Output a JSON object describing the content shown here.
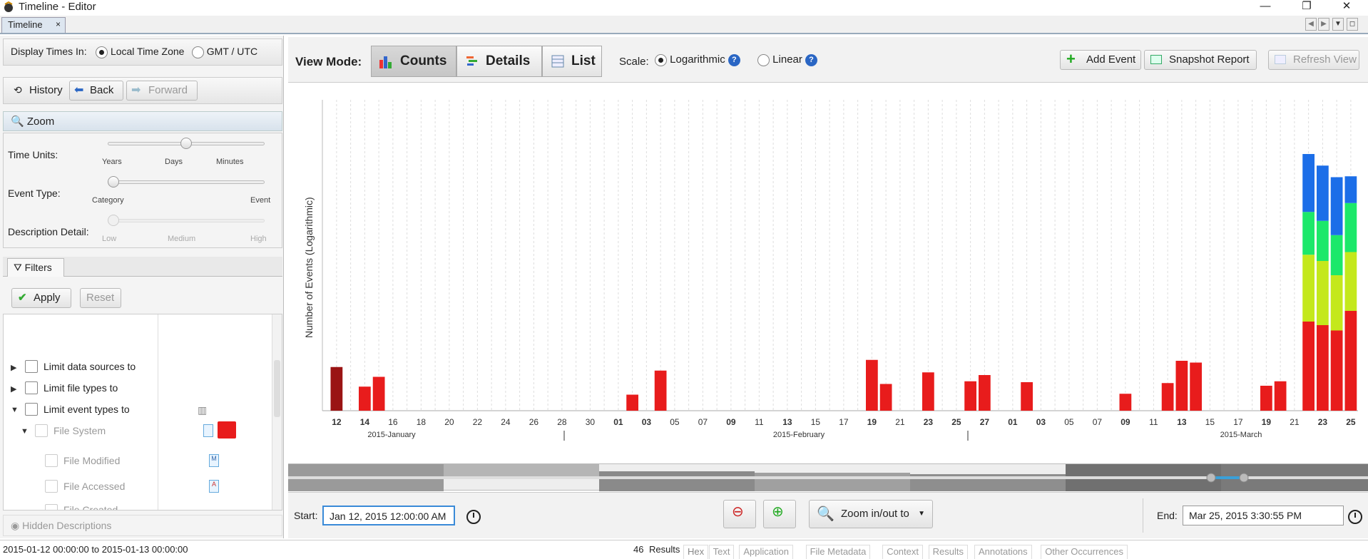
{
  "window": {
    "title": "Timeline - Editor",
    "minimize": "—",
    "restore": "❐",
    "close": "✕"
  },
  "tabs": {
    "timeline": "Timeline",
    "close": "×"
  },
  "display_times": {
    "label": "Display Times In:",
    "local": "Local Time Zone",
    "gmt": "GMT / UTC",
    "selected": "local"
  },
  "history": {
    "label": "History",
    "back": "Back",
    "forward": "Forward"
  },
  "zoom": {
    "title": "Zoom",
    "time_units": {
      "label": "Time Units:",
      "ticks": [
        "Years",
        "Days",
        "Minutes"
      ],
      "level": 0.5
    },
    "event_type": {
      "label": "Event Type:",
      "ticks": [
        "Category",
        "Event"
      ],
      "level": 0.0
    },
    "description_detail": {
      "label": "Description Detail:",
      "ticks": [
        "Low",
        "Medium",
        "High"
      ],
      "level": 0.0
    }
  },
  "filters": {
    "title": "Filters",
    "apply": "Apply",
    "reset": "Reset",
    "items": [
      "Limit data sources to",
      "Limit file types to",
      "Limit event types to",
      "File System",
      "File Modified",
      "File Accessed",
      "File Created"
    ]
  },
  "hidden_descriptions": "Hidden Descriptions",
  "toolbar": {
    "view_mode_label": "View Mode:",
    "modes": [
      "Counts",
      "Details",
      "List"
    ],
    "active_mode": "Counts",
    "scale_label": "Scale:",
    "scale_options": [
      "Logarithmic",
      "Linear"
    ],
    "scale_selected": "Logarithmic",
    "help": "?",
    "add_event": "Add Event",
    "snapshot_report": "Snapshot Report",
    "refresh_view": "Refresh View"
  },
  "chart_data": {
    "type": "bar",
    "stacked": true,
    "ylabel": "Number of Events (Logarithmic)",
    "scale": "logarithmic",
    "grid": true,
    "tick_labels": [
      "12",
      "14",
      "16",
      "18",
      "20",
      "22",
      "24",
      "26",
      "28",
      "30",
      "01",
      "03",
      "05",
      "07",
      "09",
      "11",
      "13",
      "15",
      "17",
      "19",
      "21",
      "23",
      "25",
      "27",
      "01",
      "03",
      "05",
      "07",
      "09",
      "11",
      "13",
      "15",
      "17",
      "19",
      "21",
      "23",
      "25"
    ],
    "bold_ticks": [
      "12",
      "14",
      "01",
      "03",
      "19",
      "23",
      "27",
      "09",
      "13",
      "23",
      "25"
    ],
    "month_labels": [
      "2015-January",
      "2015-February",
      "2015-March"
    ],
    "colors": {
      "red": "#e81c1c",
      "yellow": "#c4e81c",
      "green": "#1ce86a",
      "blue": "#1c6ee8"
    },
    "bars": [
      {
        "date": "2015-01-12",
        "red": 0.49,
        "selected": true
      },
      {
        "date": "2015-01-14",
        "red": 0.27
      },
      {
        "date": "2015-01-15",
        "red": 0.38
      },
      {
        "date": "2015-02-02",
        "red": 0.18
      },
      {
        "date": "2015-02-04",
        "red": 0.45
      },
      {
        "date": "2015-02-19",
        "red": 0.57
      },
      {
        "date": "2015-02-20",
        "red": 0.3
      },
      {
        "date": "2015-02-23",
        "red": 0.43
      },
      {
        "date": "2015-02-26",
        "red": 0.33
      },
      {
        "date": "2015-02-27",
        "red": 0.4
      },
      {
        "date": "2015-03-02",
        "red": 0.32
      },
      {
        "date": "2015-03-09",
        "red": 0.19
      },
      {
        "date": "2015-03-12",
        "red": 0.31
      },
      {
        "date": "2015-03-13",
        "red": 0.56
      },
      {
        "date": "2015-03-14",
        "red": 0.54
      },
      {
        "date": "2015-03-19",
        "red": 0.28
      },
      {
        "date": "2015-03-20",
        "red": 0.33
      },
      {
        "date": "2015-03-22",
        "red": 1.0,
        "yellow": 0.75,
        "green": 0.48,
        "blue": 0.65
      },
      {
        "date": "2015-03-23",
        "red": 0.96,
        "yellow": 0.72,
        "green": 0.45,
        "blue": 0.62
      },
      {
        "date": "2015-03-24",
        "red": 0.9,
        "yellow": 0.62,
        "green": 0.45,
        "blue": 0.65
      },
      {
        "date": "2015-03-25",
        "red": 1.12,
        "yellow": 0.66,
        "green": 0.55,
        "blue": 0.3
      }
    ]
  },
  "date_range": {
    "start_label": "Start:",
    "start_value": "Jan 12, 2015 12:00:00 AM",
    "end_label": "End:",
    "end_value": "Mar 25, 2015 3:30:55 PM",
    "zoom_dropdown": "Zoom in/out to"
  },
  "status": {
    "range": "2015-01-12 00:00:00 to 2015-01-13 00:00:00",
    "results_count": "46",
    "results_label": "Results"
  },
  "bottom_tabs": [
    "Hex",
    "Text",
    "Application",
    "File Metadata",
    "Context",
    "Results",
    "Annotations",
    "Other Occurrences"
  ]
}
